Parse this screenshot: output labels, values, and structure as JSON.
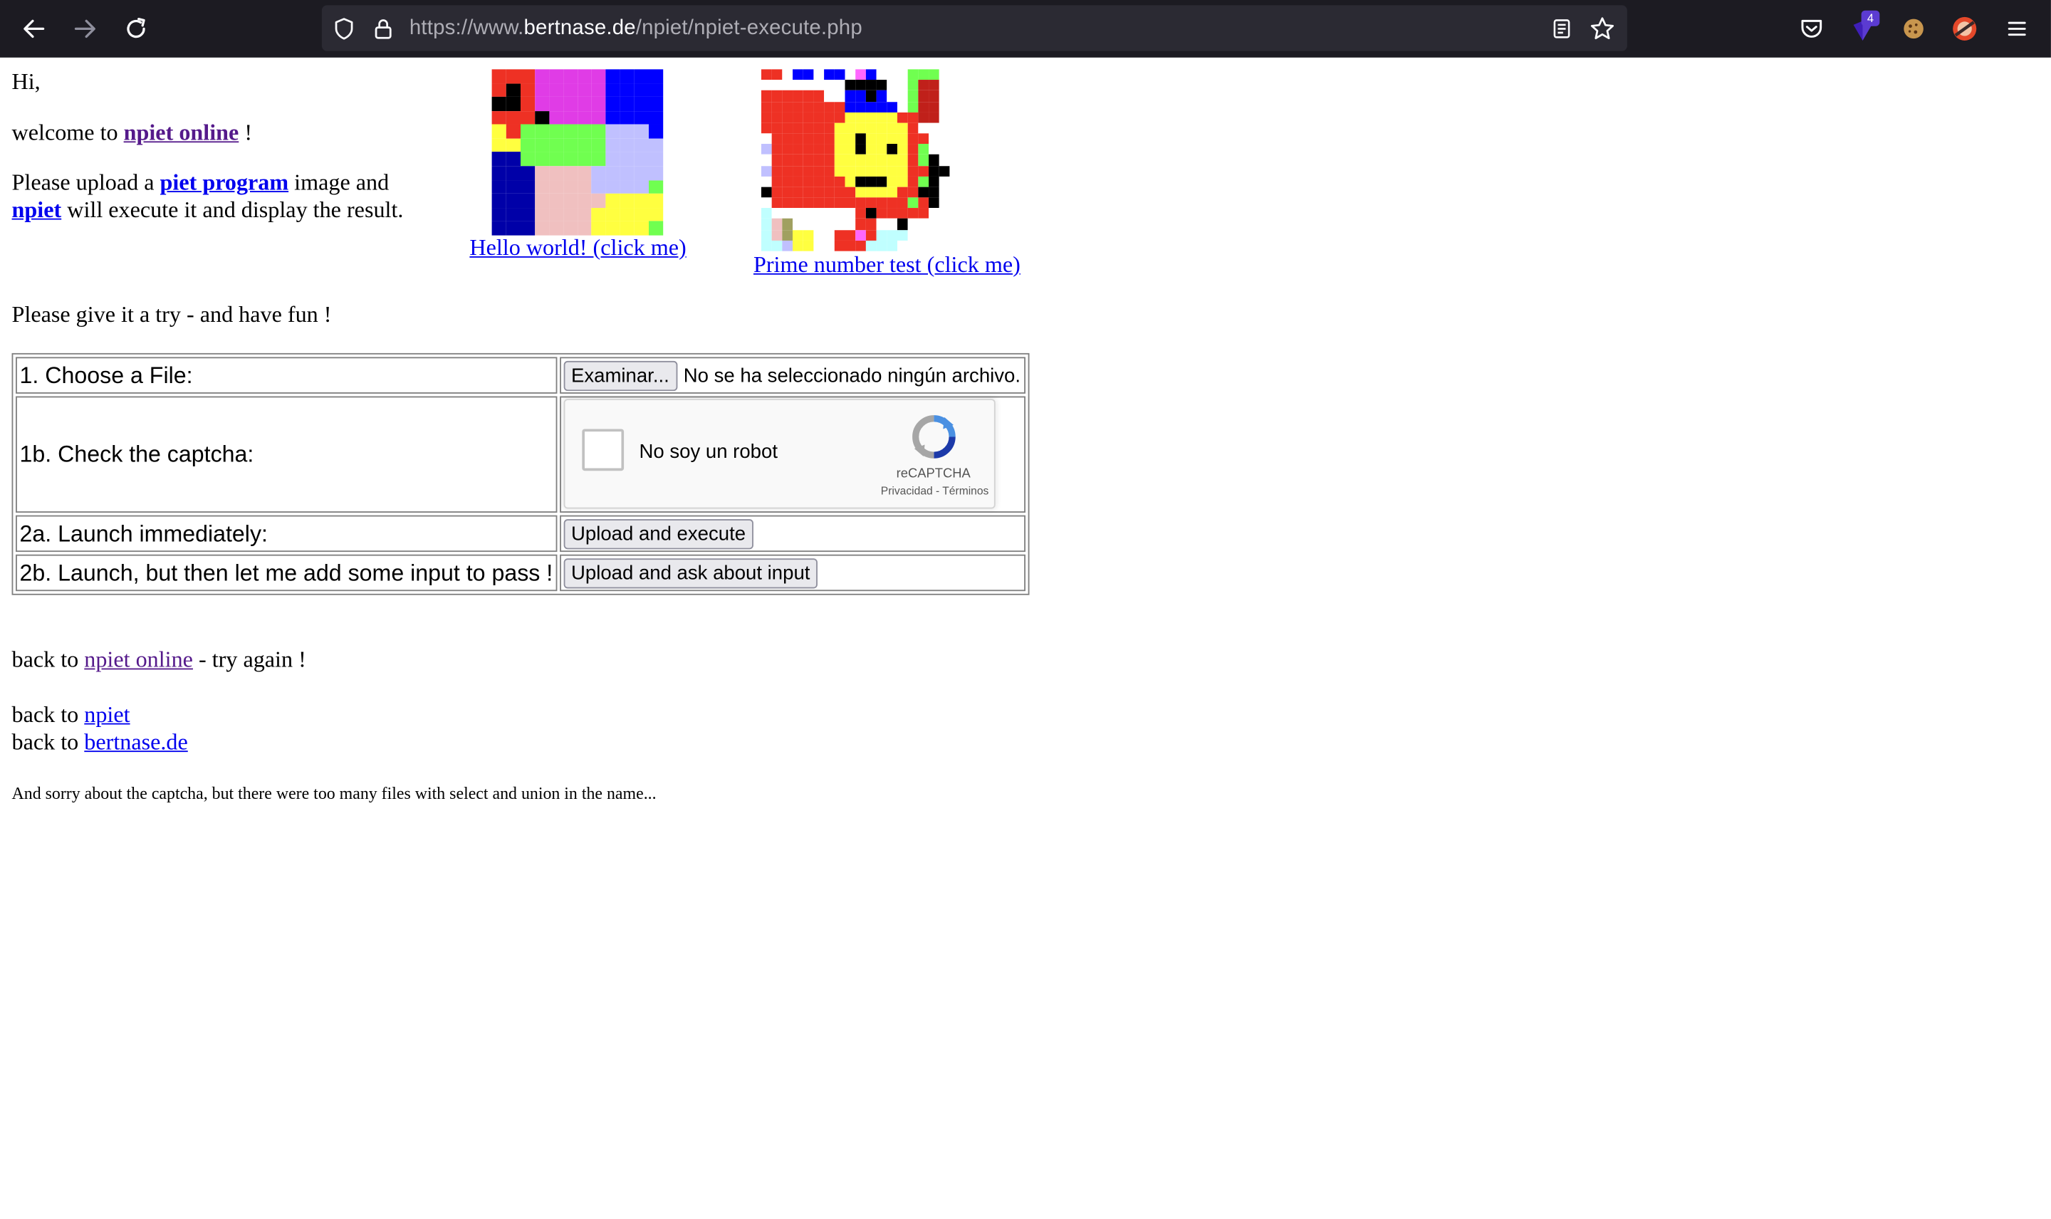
{
  "browser": {
    "url_prefix": "https://www.",
    "url_host": "bertnase.de",
    "url_path": "/npiet/npiet-execute.php",
    "extension_badge": "4"
  },
  "intro": {
    "greeting": "Hi,",
    "welcome_prefix": "welcome to ",
    "welcome_link": "npiet online",
    "welcome_suffix": " !",
    "upload_prefix": "Please upload a ",
    "upload_link": "piet program",
    "upload_suffix": " image and",
    "npiet_link": "npiet",
    "execute_suffix": " will execute it and display the result.",
    "try_text": "Please give it a try - and have fun !"
  },
  "examples": {
    "hello_world": "Hello world! (click me)",
    "prime_test": "Prime number test (click me)"
  },
  "form": {
    "row1_label": "1. Choose a File:",
    "file_button": "Examinar...",
    "file_status": "No se ha seleccionado ningún archivo.",
    "row1b_label": "1b. Check the captcha:",
    "captcha_label": "No soy un robot",
    "captcha_brand": "reCAPTCHA",
    "captcha_terms": "Privacidad - Términos",
    "row2a_label": "2a. Launch immediately:",
    "upload_execute": "Upload and execute",
    "row2b_label": "2b. Launch, but then let me add some input to pass !",
    "upload_input": "Upload and ask about input"
  },
  "footer": {
    "back_prefix": "back to ",
    "online_link": "npiet online",
    "try_again": " - try again !",
    "npiet_link": "npiet",
    "bertnase_link": "bertnase.de",
    "sorry": "And sorry about the captcha, but there were too many files with select and union in the name..."
  }
}
